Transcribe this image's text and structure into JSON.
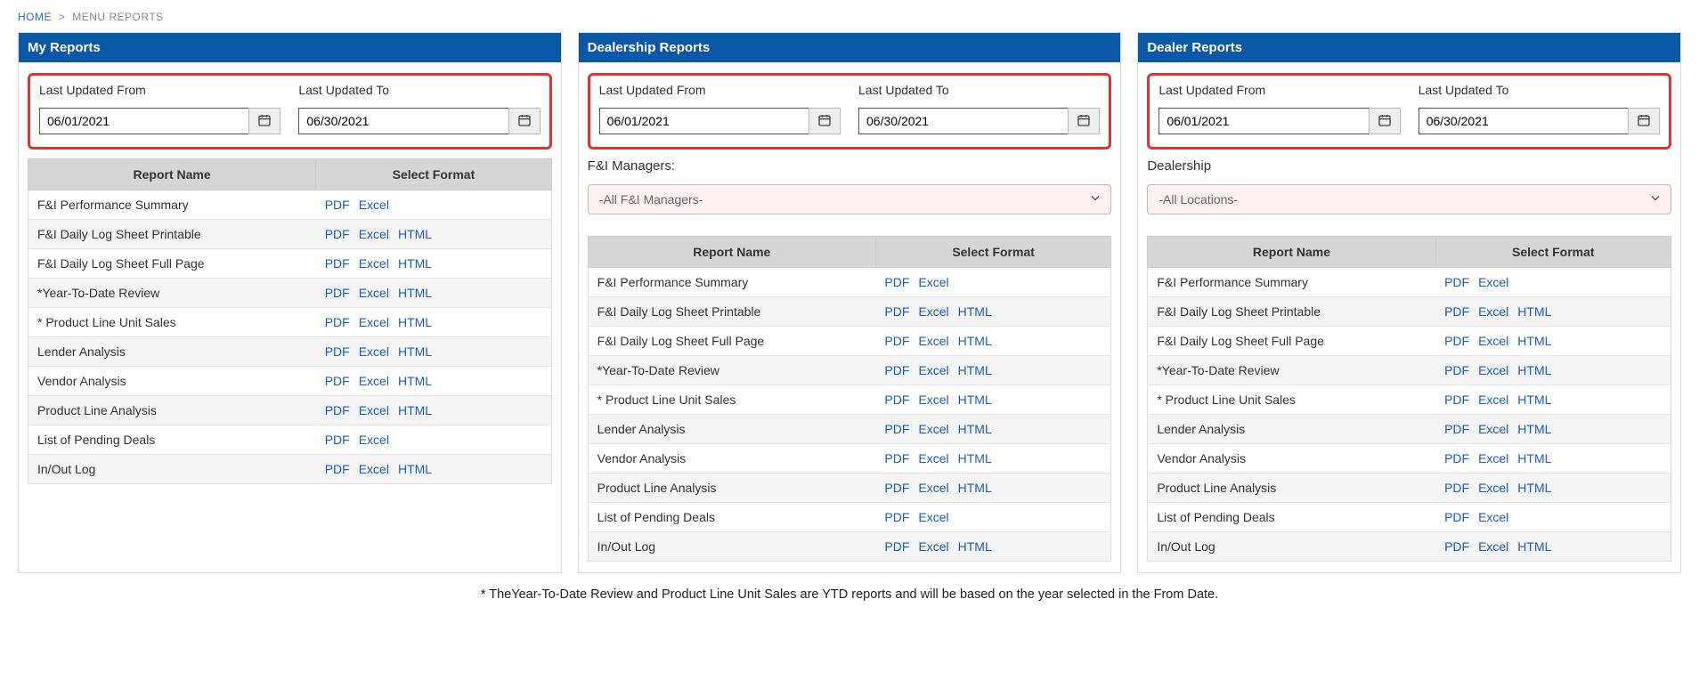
{
  "breadcrumb": {
    "home": "HOME",
    "current": "MENU REPORTS"
  },
  "labels": {
    "updated_from": "Last Updated From",
    "updated_to": "Last Updated To",
    "report_name": "Report Name",
    "select_format": "Select Format",
    "fi_managers": "F&I Managers:",
    "dealership": "Dealership"
  },
  "dates": {
    "from": "06/01/2021",
    "to": "06/30/2021"
  },
  "formats": {
    "pdf": "PDF",
    "excel": "Excel",
    "html": "HTML"
  },
  "selects": {
    "fi_managers_selected": "-All F&I Managers-",
    "dealership_selected": "-All Locations-"
  },
  "panels": {
    "my": {
      "title": "My Reports"
    },
    "dealership": {
      "title": "Dealership Reports"
    },
    "dealer": {
      "title": "Dealer Reports"
    }
  },
  "my_reports": [
    {
      "name": "F&I Performance Summary",
      "formats": [
        "pdf",
        "excel"
      ]
    },
    {
      "name": "F&I Daily Log Sheet Printable",
      "formats": [
        "pdf",
        "excel",
        "html"
      ]
    },
    {
      "name": "F&I Daily Log Sheet Full Page",
      "formats": [
        "pdf",
        "excel",
        "html"
      ]
    },
    {
      "name": "*Year-To-Date Review",
      "formats": [
        "pdf",
        "excel",
        "html"
      ]
    },
    {
      "name": "* Product Line Unit Sales",
      "formats": [
        "pdf",
        "excel",
        "html"
      ]
    },
    {
      "name": "Lender Analysis",
      "formats": [
        "pdf",
        "excel",
        "html"
      ]
    },
    {
      "name": "Vendor Analysis",
      "formats": [
        "pdf",
        "excel",
        "html"
      ]
    },
    {
      "name": "Product Line Analysis",
      "formats": [
        "pdf",
        "excel",
        "html"
      ]
    },
    {
      "name": "List of Pending Deals",
      "formats": [
        "pdf",
        "excel"
      ]
    },
    {
      "name": "In/Out Log",
      "formats": [
        "pdf",
        "excel",
        "html"
      ]
    }
  ],
  "dealership_reports": [
    {
      "name": "F&I Performance Summary",
      "formats": [
        "pdf",
        "excel"
      ]
    },
    {
      "name": "F&I Daily Log Sheet Printable",
      "formats": [
        "pdf",
        "excel",
        "html"
      ]
    },
    {
      "name": "F&I Daily Log Sheet Full Page",
      "formats": [
        "pdf",
        "excel",
        "html"
      ]
    },
    {
      "name": "*Year-To-Date Review",
      "formats": [
        "pdf",
        "excel",
        "html"
      ]
    },
    {
      "name": "* Product Line Unit Sales",
      "formats": [
        "pdf",
        "excel",
        "html"
      ]
    },
    {
      "name": "Lender Analysis",
      "formats": [
        "pdf",
        "excel",
        "html"
      ]
    },
    {
      "name": "Vendor Analysis",
      "formats": [
        "pdf",
        "excel",
        "html"
      ]
    },
    {
      "name": "Product Line Analysis",
      "formats": [
        "pdf",
        "excel",
        "html"
      ]
    },
    {
      "name": "List of Pending Deals",
      "formats": [
        "pdf",
        "excel"
      ]
    },
    {
      "name": "In/Out Log",
      "formats": [
        "pdf",
        "excel",
        "html"
      ]
    }
  ],
  "dealer_reports": [
    {
      "name": "F&I Performance Summary",
      "formats": [
        "pdf",
        "excel"
      ]
    },
    {
      "name": "F&I Daily Log Sheet Printable",
      "formats": [
        "pdf",
        "excel",
        "html"
      ]
    },
    {
      "name": "F&I Daily Log Sheet Full Page",
      "formats": [
        "pdf",
        "excel",
        "html"
      ]
    },
    {
      "name": "*Year-To-Date Review",
      "formats": [
        "pdf",
        "excel",
        "html"
      ]
    },
    {
      "name": "* Product Line Unit Sales",
      "formats": [
        "pdf",
        "excel",
        "html"
      ]
    },
    {
      "name": "Lender Analysis",
      "formats": [
        "pdf",
        "excel",
        "html"
      ]
    },
    {
      "name": "Vendor Analysis",
      "formats": [
        "pdf",
        "excel",
        "html"
      ]
    },
    {
      "name": "Product Line Analysis",
      "formats": [
        "pdf",
        "excel",
        "html"
      ]
    },
    {
      "name": "List of Pending Deals",
      "formats": [
        "pdf",
        "excel"
      ]
    },
    {
      "name": "In/Out Log",
      "formats": [
        "pdf",
        "excel",
        "html"
      ]
    }
  ],
  "footnote": "* TheYear-To-Date Review and Product Line Unit Sales are YTD reports and will be based on the year selected in the From Date."
}
